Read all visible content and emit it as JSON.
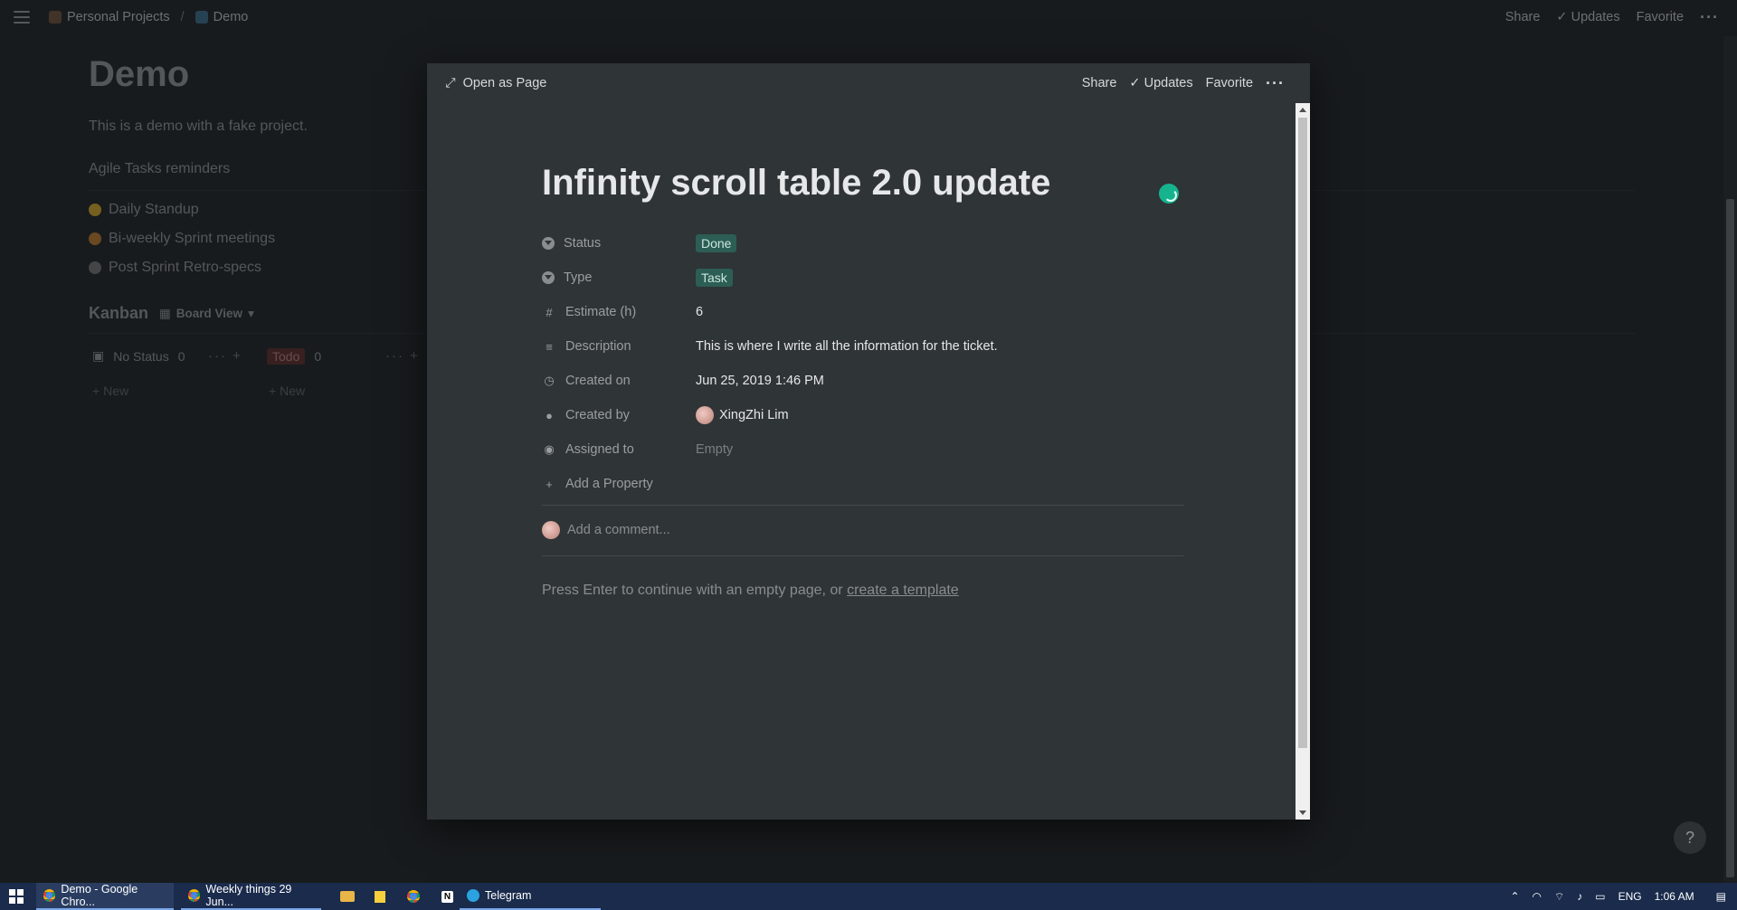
{
  "topbar": {
    "breadcrumb": [
      "Personal Projects",
      "Demo"
    ],
    "actions": [
      "Share",
      "Updates",
      "Favorite"
    ]
  },
  "page": {
    "title": "Demo",
    "description": "This is a demo with a fake project.",
    "section_heading": "Agile Tasks reminders",
    "bullets": [
      "Daily Standup",
      "Bi-weekly Sprint meetings",
      "Post Sprint Retro-specs"
    ],
    "kanban_title": "Kanban",
    "board_view": "Board View",
    "columns": [
      {
        "label": "No Status",
        "count": "0",
        "new": "New"
      },
      {
        "label": "Todo",
        "count": "0",
        "new": "New"
      }
    ]
  },
  "modal": {
    "open_as_page": "Open as Page",
    "actions": [
      "Share",
      "Updates",
      "Favorite"
    ],
    "title": "Infinity scroll table 2.0 update",
    "properties": [
      {
        "key": "Status",
        "value": "Done"
      },
      {
        "key": "Type",
        "value": "Task"
      },
      {
        "key": "Estimate (h)",
        "value": "6"
      },
      {
        "key": "Description",
        "value": "This is where I write all the information for the ticket."
      },
      {
        "key": "Created on",
        "value": "Jun 25, 2019 1:46 PM"
      },
      {
        "key": "Created by",
        "value": "XingZhi Lim"
      },
      {
        "key": "Assigned to",
        "value": "Empty"
      }
    ],
    "add_property": "Add a Property",
    "comment_placeholder": "Add a comment...",
    "enter_hint": "Press Enter to continue with an empty page, or",
    "create_template": "create a template"
  },
  "help_label": "?",
  "taskbar": {
    "items": [
      "Demo - Google Chro...",
      "Weekly things 29 Jun...",
      "Telegram"
    ],
    "notion_letter": "N",
    "language": "ENG",
    "time": "1:06 AM"
  },
  "colors": {
    "accent": "#16b38f",
    "tag_green": "#2c5e55",
    "tag_red": "#5a2c2a",
    "taskbar": "#1a2b4c"
  }
}
